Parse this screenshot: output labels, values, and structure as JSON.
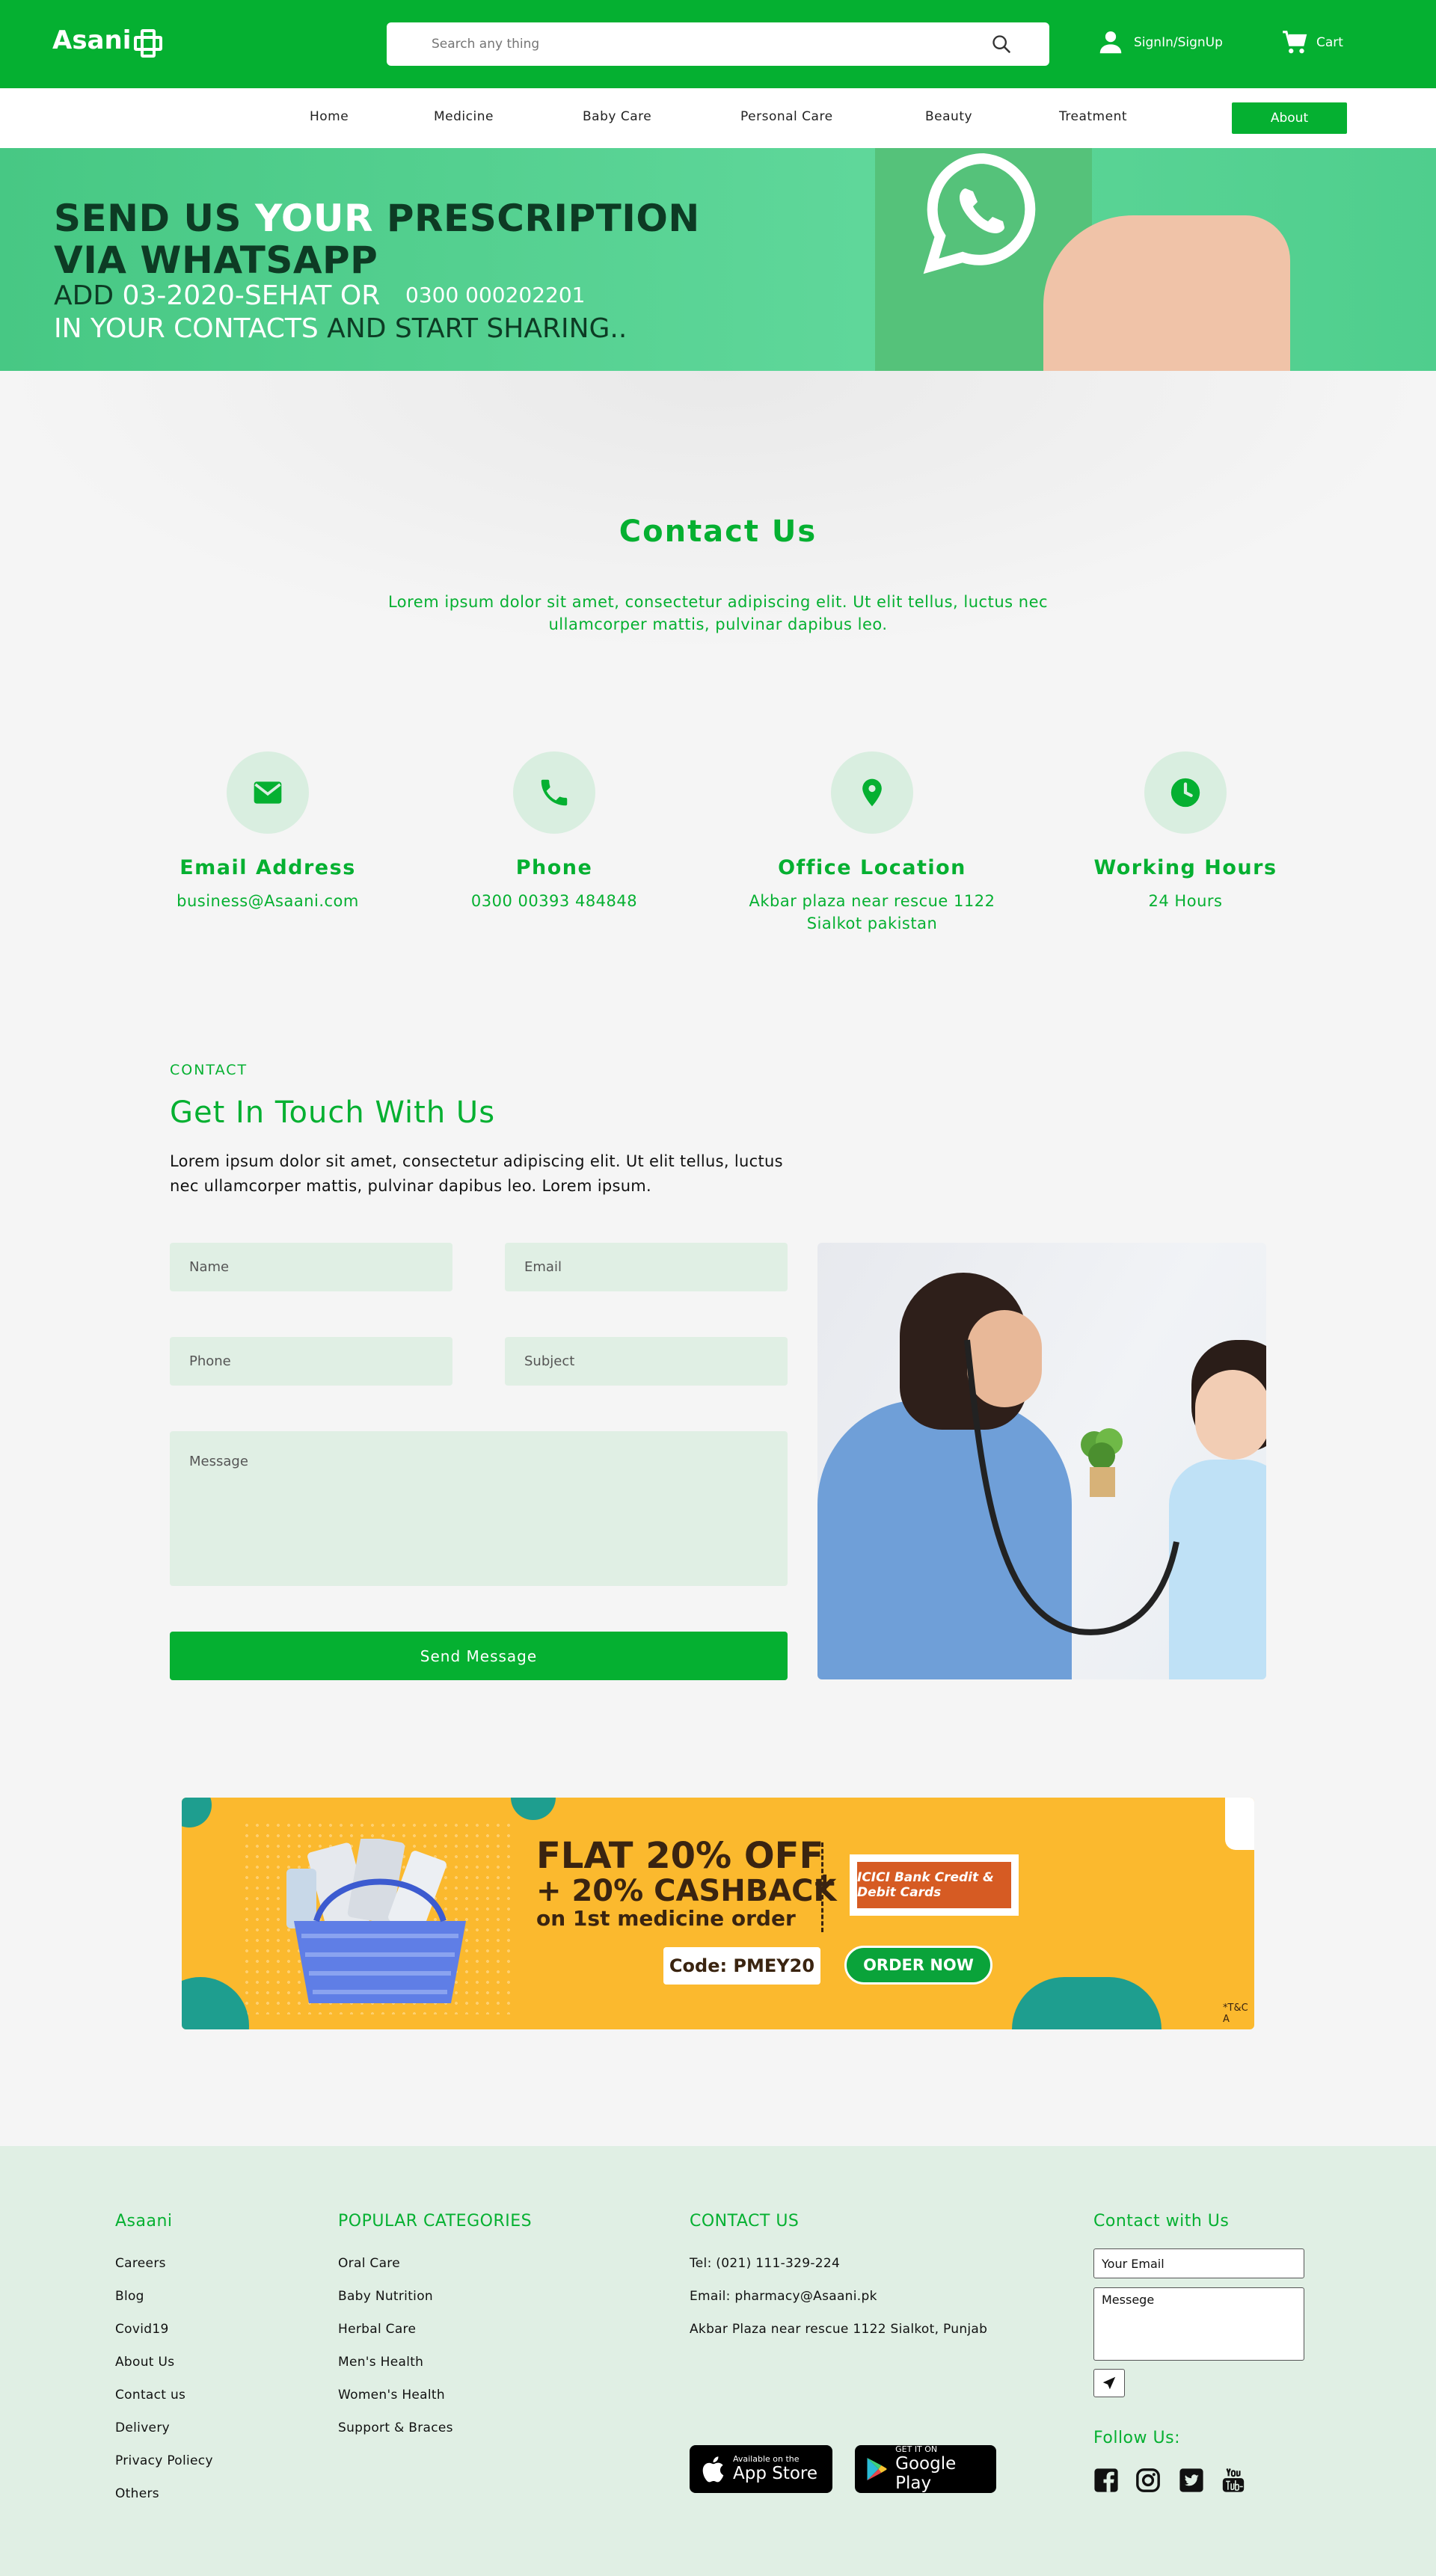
{
  "header": {
    "logo": "Asani",
    "search_placeholder": "Search any thing",
    "signin_label": "SignIn/SignUp",
    "cart_label": "Cart"
  },
  "nav": {
    "items": [
      "Home",
      "Medicine",
      "Baby Care",
      "Personal Care",
      "Beauty",
      "Treatment"
    ],
    "about_label": "About"
  },
  "banner": {
    "line1_a": "SEND US ",
    "line1_b": "YOUR",
    "line1_c": " PRESCRIPTION",
    "line2": "VIA WHATSAPP",
    "line3_a": "ADD ",
    "line3_b": "03-2020-SEHAT OR",
    "line4_a": "IN YOUR CONTACTS",
    "line4_b": " AND START SHARING..",
    "alt_number": "0300 000202201"
  },
  "contact": {
    "title": "Contact Us",
    "description": "Lorem ipsum dolor sit amet, consectetur adipiscing elit. Ut elit tellus, luctus nec ullamcorper mattis, pulvinar dapibus leo."
  },
  "info_cards": [
    {
      "label": "Email Address",
      "value": "business@Asaani.com",
      "icon": "email-icon"
    },
    {
      "label": "Phone",
      "value": "0300 00393 484848",
      "icon": "phone-icon"
    },
    {
      "label": "Office Location",
      "value": "Akbar plaza near rescue 1122 Sialkot pakistan",
      "icon": "location-pin-icon"
    },
    {
      "label": "Working Hours",
      "value": "24 Hours",
      "icon": "clock-icon"
    }
  ],
  "touch": {
    "eyebrow": "CONTACT",
    "title": "Get In Touch With Us",
    "description": "Lorem ipsum dolor sit amet, consectetur adipiscing elit. Ut elit tellus, luctus nec ullamcorper mattis, pulvinar dapibus leo. Lorem ipsum.",
    "name_placeholder": "Name",
    "email_placeholder": "Email",
    "phone_placeholder": "Phone",
    "subject_placeholder": "Subject",
    "message_placeholder": "Message",
    "send_label": "Send Message"
  },
  "promo": {
    "line1": "FLAT 20% OFF",
    "line2": "+ 20% CASHBACK",
    "line3": "on 1st medicine order",
    "plus": "+",
    "bank": "ICICI Bank Credit & Debit Cards",
    "code": "Code: PMEY20",
    "order_label": "ORDER NOW",
    "tc": "*T&C A"
  },
  "footer": {
    "brand_title": "Asaani",
    "brand_links": [
      "Careers",
      "Blog",
      "Covid19",
      "About Us",
      "Contact us",
      "Delivery",
      "Privacy Poliecy",
      "Others"
    ],
    "categories_title": "POPULAR CATEGORIES",
    "categories": [
      "Oral Care",
      "Baby Nutrition",
      "Herbal Care",
      "Men's Health",
      "Women's Health",
      "Support & Braces"
    ],
    "contact_title": "CONTACT US",
    "contact_lines": [
      "Tel: (021) 111-329-224",
      "Email: pharmacy@Asaani.pk",
      "Akbar Plaza near rescue 1122 Sialkot, Punjab"
    ],
    "connect_title": "Contact with Us",
    "email_placeholder": "Your Email",
    "message_placeholder": "Messege",
    "follow_title": "Follow Us:",
    "appstore_small": "Available on the",
    "appstore_big": "App Store",
    "play_small": "GET IT ON",
    "play_big": "Google Play"
  },
  "colors": {
    "brand_green": "#05b031",
    "light_green": "#e0efe4",
    "promo_yellow": "#fbb92e",
    "teal": "#1e9e8f"
  }
}
